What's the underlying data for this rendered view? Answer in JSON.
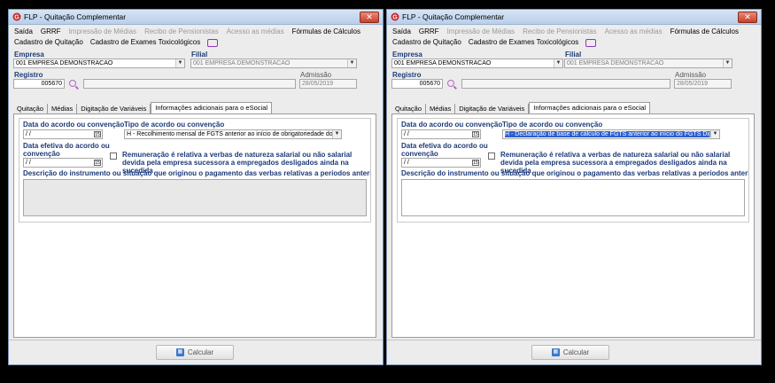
{
  "window": {
    "title": "FLP - Quitação Complementar",
    "close_label": "✕"
  },
  "menu": {
    "items": [
      {
        "label": "Saída",
        "enabled": true
      },
      {
        "label": "GRRF",
        "enabled": true
      },
      {
        "label": "Impressão de Médias",
        "enabled": false
      },
      {
        "label": "Recibo de Pensionistas",
        "enabled": false
      },
      {
        "label": "Acesso as médias",
        "enabled": false
      },
      {
        "label": "Fórmulas de Cálculos",
        "enabled": true
      }
    ],
    "row2": [
      "Cadastro de Quitação",
      "Cadastro de Exames Toxicológicos"
    ]
  },
  "form": {
    "empresa_label": "Empresa",
    "empresa_value": "001 EMPRESA DEMONSTRACAO",
    "filial_label": "Filial",
    "filial_value": "001 EMPRESA DEMONSTRACAO",
    "registro_label": "Registro",
    "registro_value": "005670",
    "admissao_label": "Admissão",
    "admissao_value": "28/05/2019"
  },
  "tabs": [
    "Quitação",
    "Médias",
    "Digitação de Variáveis",
    "Informações adicionais para o eSocial"
  ],
  "esocial": {
    "data_acordo_label": "Data do acordo ou convenção",
    "data_acordo_value": " / /",
    "tipo_acordo_label": "Tipo de acordo ou convenção",
    "data_efetiva_label": "Data efetiva do acordo ou convenção",
    "data_efetiva_value": " / /",
    "remuneracao_label": "Remuneração é relativa a verbas de natureza salarial ou não salarial devida pela empresa sucessora a empregados desligados ainda na sucedida",
    "descricao_label": "Descrição do instrumento ou situação que originou o pagamento das verbas relativas a períodos anteriores",
    "calendar_glyph": "15"
  },
  "left_window": {
    "tipo_acordo_value": "H - Recolhimento mensal de FGTS anterior ao início de obrigatoriedade dos e"
  },
  "right_window": {
    "tipo_acordo_value": "H - Declaração de base de cálculo de FGTS anterior ao início do FGTS Digit"
  },
  "buttons": {
    "calcular": "Calcular"
  },
  "colors": {
    "label_blue": "#1c3a78",
    "selection": "#2c5fd0",
    "titlebar": "#c5d8f0"
  }
}
